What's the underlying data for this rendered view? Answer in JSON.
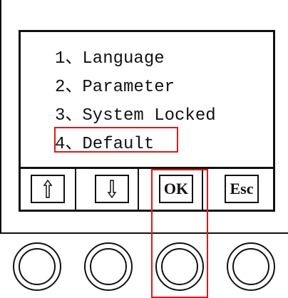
{
  "menu": {
    "items": [
      {
        "label": "1、Language"
      },
      {
        "label": "2、Parameter"
      },
      {
        "label": "3、System Locked"
      },
      {
        "label": "4、Default"
      }
    ],
    "highlighted_index": 3
  },
  "softkeys": {
    "up_icon": "up-arrow-icon",
    "down_icon": "down-arrow-icon",
    "ok_label": "OK",
    "esc_label": "Esc"
  },
  "colors": {
    "highlight": "#e01818",
    "lines": "#111111"
  }
}
